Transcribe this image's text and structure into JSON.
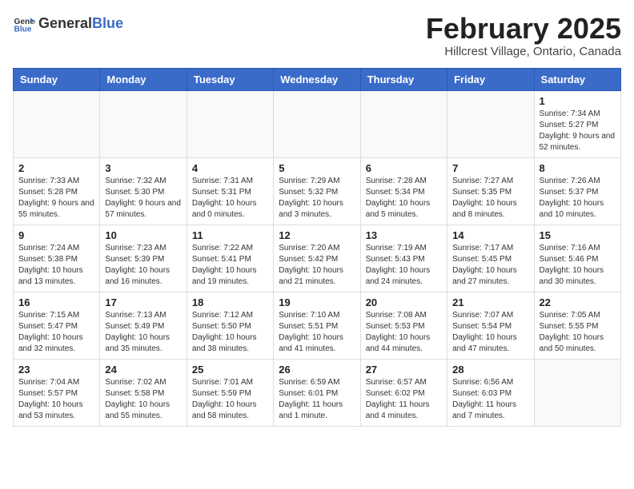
{
  "header": {
    "logo_general": "General",
    "logo_blue": "Blue",
    "title": "February 2025",
    "subtitle": "Hillcrest Village, Ontario, Canada"
  },
  "columns": [
    "Sunday",
    "Monday",
    "Tuesday",
    "Wednesday",
    "Thursday",
    "Friday",
    "Saturday"
  ],
  "weeks": [
    [
      {
        "day": "",
        "info": ""
      },
      {
        "day": "",
        "info": ""
      },
      {
        "day": "",
        "info": ""
      },
      {
        "day": "",
        "info": ""
      },
      {
        "day": "",
        "info": ""
      },
      {
        "day": "",
        "info": ""
      },
      {
        "day": "1",
        "info": "Sunrise: 7:34 AM\nSunset: 5:27 PM\nDaylight: 9 hours and 52 minutes."
      }
    ],
    [
      {
        "day": "2",
        "info": "Sunrise: 7:33 AM\nSunset: 5:28 PM\nDaylight: 9 hours and 55 minutes."
      },
      {
        "day": "3",
        "info": "Sunrise: 7:32 AM\nSunset: 5:30 PM\nDaylight: 9 hours and 57 minutes."
      },
      {
        "day": "4",
        "info": "Sunrise: 7:31 AM\nSunset: 5:31 PM\nDaylight: 10 hours and 0 minutes."
      },
      {
        "day": "5",
        "info": "Sunrise: 7:29 AM\nSunset: 5:32 PM\nDaylight: 10 hours and 3 minutes."
      },
      {
        "day": "6",
        "info": "Sunrise: 7:28 AM\nSunset: 5:34 PM\nDaylight: 10 hours and 5 minutes."
      },
      {
        "day": "7",
        "info": "Sunrise: 7:27 AM\nSunset: 5:35 PM\nDaylight: 10 hours and 8 minutes."
      },
      {
        "day": "8",
        "info": "Sunrise: 7:26 AM\nSunset: 5:37 PM\nDaylight: 10 hours and 10 minutes."
      }
    ],
    [
      {
        "day": "9",
        "info": "Sunrise: 7:24 AM\nSunset: 5:38 PM\nDaylight: 10 hours and 13 minutes."
      },
      {
        "day": "10",
        "info": "Sunrise: 7:23 AM\nSunset: 5:39 PM\nDaylight: 10 hours and 16 minutes."
      },
      {
        "day": "11",
        "info": "Sunrise: 7:22 AM\nSunset: 5:41 PM\nDaylight: 10 hours and 19 minutes."
      },
      {
        "day": "12",
        "info": "Sunrise: 7:20 AM\nSunset: 5:42 PM\nDaylight: 10 hours and 21 minutes."
      },
      {
        "day": "13",
        "info": "Sunrise: 7:19 AM\nSunset: 5:43 PM\nDaylight: 10 hours and 24 minutes."
      },
      {
        "day": "14",
        "info": "Sunrise: 7:17 AM\nSunset: 5:45 PM\nDaylight: 10 hours and 27 minutes."
      },
      {
        "day": "15",
        "info": "Sunrise: 7:16 AM\nSunset: 5:46 PM\nDaylight: 10 hours and 30 minutes."
      }
    ],
    [
      {
        "day": "16",
        "info": "Sunrise: 7:15 AM\nSunset: 5:47 PM\nDaylight: 10 hours and 32 minutes."
      },
      {
        "day": "17",
        "info": "Sunrise: 7:13 AM\nSunset: 5:49 PM\nDaylight: 10 hours and 35 minutes."
      },
      {
        "day": "18",
        "info": "Sunrise: 7:12 AM\nSunset: 5:50 PM\nDaylight: 10 hours and 38 minutes."
      },
      {
        "day": "19",
        "info": "Sunrise: 7:10 AM\nSunset: 5:51 PM\nDaylight: 10 hours and 41 minutes."
      },
      {
        "day": "20",
        "info": "Sunrise: 7:08 AM\nSunset: 5:53 PM\nDaylight: 10 hours and 44 minutes."
      },
      {
        "day": "21",
        "info": "Sunrise: 7:07 AM\nSunset: 5:54 PM\nDaylight: 10 hours and 47 minutes."
      },
      {
        "day": "22",
        "info": "Sunrise: 7:05 AM\nSunset: 5:55 PM\nDaylight: 10 hours and 50 minutes."
      }
    ],
    [
      {
        "day": "23",
        "info": "Sunrise: 7:04 AM\nSunset: 5:57 PM\nDaylight: 10 hours and 53 minutes."
      },
      {
        "day": "24",
        "info": "Sunrise: 7:02 AM\nSunset: 5:58 PM\nDaylight: 10 hours and 55 minutes."
      },
      {
        "day": "25",
        "info": "Sunrise: 7:01 AM\nSunset: 5:59 PM\nDaylight: 10 hours and 58 minutes."
      },
      {
        "day": "26",
        "info": "Sunrise: 6:59 AM\nSunset: 6:01 PM\nDaylight: 11 hours and 1 minute."
      },
      {
        "day": "27",
        "info": "Sunrise: 6:57 AM\nSunset: 6:02 PM\nDaylight: 11 hours and 4 minutes."
      },
      {
        "day": "28",
        "info": "Sunrise: 6:56 AM\nSunset: 6:03 PM\nDaylight: 11 hours and 7 minutes."
      },
      {
        "day": "",
        "info": ""
      }
    ]
  ]
}
